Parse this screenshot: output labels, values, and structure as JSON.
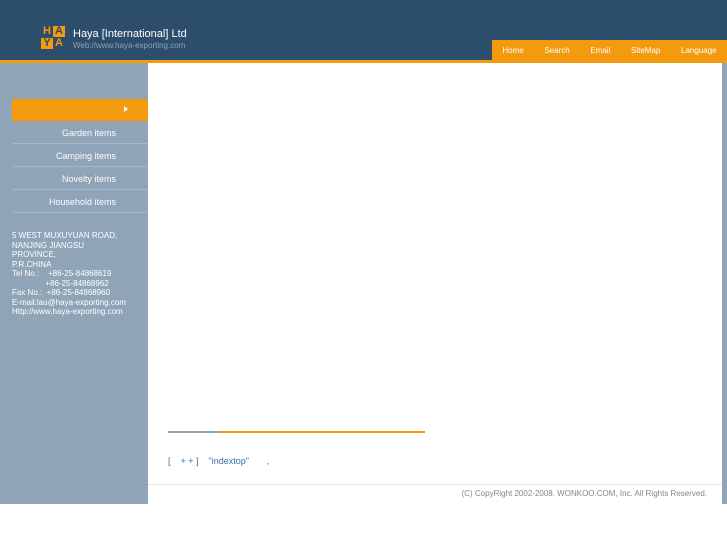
{
  "header": {
    "logo_letters": [
      "H",
      "A",
      "Y",
      "A"
    ],
    "company_name": "Haya [International] Ltd",
    "website": "Web://www.haya-exporting.com",
    "colors": {
      "background": "#2c4e6c",
      "accent": "#f39a0e"
    }
  },
  "nav": {
    "items": [
      "Home",
      "Search",
      "Email",
      "SiteMap",
      "Language"
    ]
  },
  "sidebar": {
    "active_icon": "caret-right-icon",
    "items": [
      "Garden items",
      "Camping items",
      "Novelty items",
      "Household items"
    ],
    "address_lines": [
      "5 WEST MUXUYUAN ROAD,",
      "NANJING JIANGSU",
      "PROVINCE,",
      "P.R.CHINA",
      "Tel No.:    +86-25-84868619",
      "               +86-25-84868962",
      "Fax No.:  +86-25-84868960",
      "E-mail:lau@haya-exporting.com",
      "Http://www.haya-exporting.com"
    ]
  },
  "main": {
    "code_text": "[    + + ]    \"indextop\"       ,"
  },
  "footer": {
    "copyright": "(C) CopyRight 2002-2008. WONKOO.COM, Inc. All Rights Reserved."
  }
}
